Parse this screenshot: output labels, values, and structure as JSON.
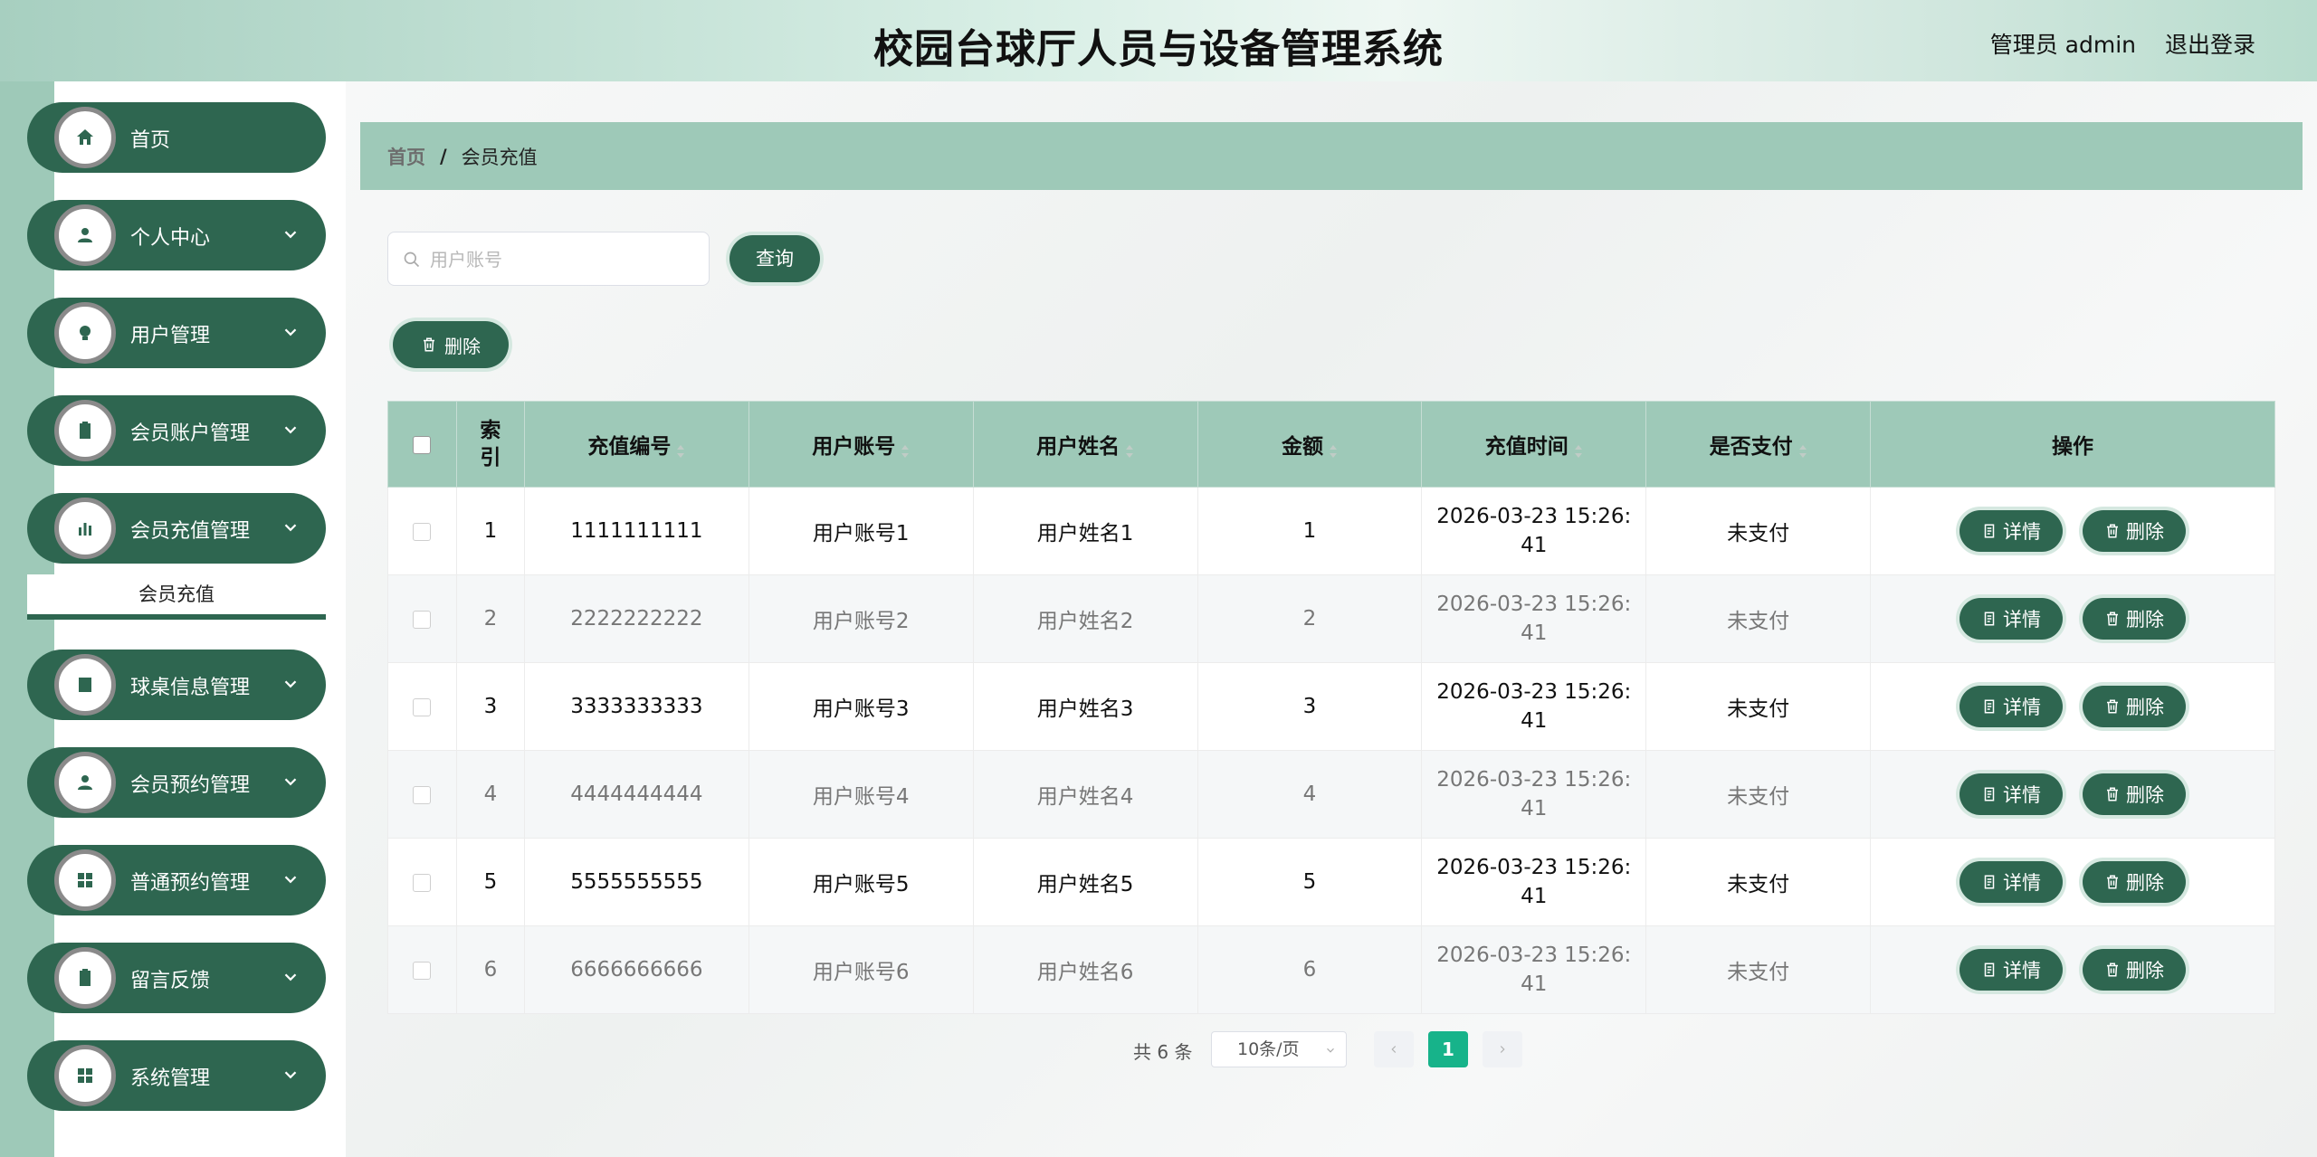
{
  "header": {
    "title": "校园台球厅人员与设备管理系统",
    "user": "管理员 admin",
    "logout": "退出登录"
  },
  "sidebar": {
    "items": [
      {
        "label": "首页",
        "icon": "home-icon"
      },
      {
        "label": "个人中心",
        "icon": "person-icon"
      },
      {
        "label": "用户管理",
        "icon": "bulb-icon"
      },
      {
        "label": "会员账户管理",
        "icon": "clipboard-icon"
      },
      {
        "label": "会员充值管理",
        "icon": "bar-chart-icon"
      },
      {
        "label": "球桌信息管理",
        "icon": "book-icon"
      },
      {
        "label": "会员预约管理",
        "icon": "person-icon"
      },
      {
        "label": "普通预约管理",
        "icon": "grid-icon"
      },
      {
        "label": "留言反馈",
        "icon": "clipboard-check-icon"
      },
      {
        "label": "系统管理",
        "icon": "grid-icon"
      }
    ],
    "submenu_active": "会员充值"
  },
  "breadcrumb": {
    "home": "首页",
    "separator": "/",
    "current": "会员充值"
  },
  "search": {
    "placeholder": "用户账号",
    "value": ""
  },
  "buttons": {
    "query": "查询",
    "delete": "删除",
    "detail": "详情"
  },
  "table": {
    "headers": [
      "索\n引",
      "充值编号",
      "用户账号",
      "用户姓名",
      "金额",
      "充值时间",
      "是否支付",
      "操作"
    ],
    "rows": [
      {
        "index": "1",
        "code": "1111111111",
        "account": "用户账号1",
        "name": "用户姓名1",
        "amount": "1",
        "time": "2026-03-23 15:26:41",
        "time_a": "2026-03-23 15:26:",
        "time_b": "41",
        "paid": "未支付"
      },
      {
        "index": "2",
        "code": "2222222222",
        "account": "用户账号2",
        "name": "用户姓名2",
        "amount": "2",
        "time": "2026-03-23 15:26:41",
        "time_a": "2026-03-23 15:26:",
        "time_b": "41",
        "paid": "未支付"
      },
      {
        "index": "3",
        "code": "3333333333",
        "account": "用户账号3",
        "name": "用户姓名3",
        "amount": "3",
        "time": "2026-03-23 15:26:41",
        "time_a": "2026-03-23 15:26:",
        "time_b": "41",
        "paid": "未支付"
      },
      {
        "index": "4",
        "code": "4444444444",
        "account": "用户账号4",
        "name": "用户姓名4",
        "amount": "4",
        "time": "2026-03-23 15:26:41",
        "time_a": "2026-03-23 15:26:",
        "time_b": "41",
        "paid": "未支付"
      },
      {
        "index": "5",
        "code": "5555555555",
        "account": "用户账号5",
        "name": "用户姓名5",
        "amount": "5",
        "time": "2026-03-23 15:26:41",
        "time_a": "2026-03-23 15:26:",
        "time_b": "41",
        "paid": "未支付"
      },
      {
        "index": "6",
        "code": "6666666666",
        "account": "用户账号6",
        "name": "用户姓名6",
        "amount": "6",
        "time": "2026-03-23 15:26:41",
        "time_a": "2026-03-23 15:26:",
        "time_b": "41",
        "paid": "未支付"
      }
    ]
  },
  "pagination": {
    "total": "共 6 条",
    "page_size": "10条/页",
    "current_page": "1"
  },
  "colors": {
    "primary": "#2e6650",
    "light": "#9ec9b8",
    "active_page": "#17b38a"
  }
}
